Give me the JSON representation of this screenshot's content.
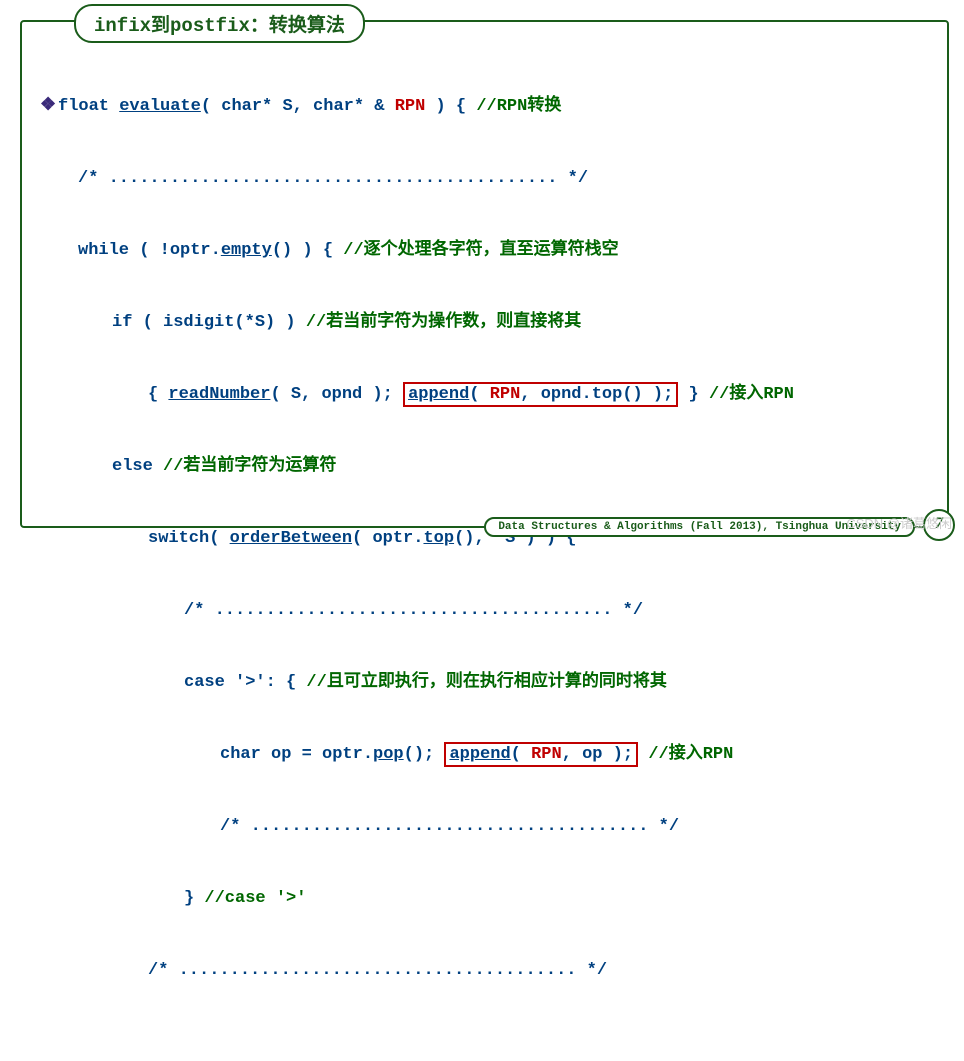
{
  "title": {
    "part1": "infix",
    "part2": "到",
    "part3": "postfix",
    "part4": "：转换算法"
  },
  "code": {
    "l1_bullet": "❖",
    "l1_a": "float ",
    "l1_fn": "evaluate",
    "l1_b": "( char* S, char* & ",
    "l1_rpn": "RPN",
    "l1_c": " ) { ",
    "l1_cmt": "//RPN转换",
    "l2": "/* ............................................ */",
    "l3_a": "while ( !optr.",
    "l3_fn": "empty",
    "l3_b": "() ) { ",
    "l3_cmt": "//逐个处理各字符，直至运算符栈空",
    "l4_a": "if ( isdigit(*S) ) ",
    "l4_cmt": "//若当前字符为操作数，则直接将其",
    "l5_a": "{ ",
    "l5_fn1": "readNumber",
    "l5_b": "( S, opnd ); ",
    "l5_fn2": "append",
    "l5_c": "( ",
    "l5_rpn": "RPN",
    "l5_d": ", opnd.top() );",
    "l5_e": " } ",
    "l5_cmt": "//接入RPN",
    "l6_a": "else ",
    "l6_cmt": "//若当前字符为运算符",
    "l7_a": "switch( ",
    "l7_fn1": "orderBetween",
    "l7_b": "( optr.",
    "l7_fn2": "top",
    "l7_c": "(), *S ) ) {",
    "l8": "/* ....................................... */",
    "l9_a": "case '>': { ",
    "l9_cmt": "//且可立即执行，则在执行相应计算的同时将其",
    "l10_a": "char op = optr.",
    "l10_fn1": "pop",
    "l10_b": "(); ",
    "l10_fn2": "append",
    "l10_c": "( ",
    "l10_rpn": "RPN",
    "l10_d": ", op );",
    "l10_e": " ",
    "l10_cmt": "//接入RPN",
    "l11": "/* ....................................... */",
    "l12_a": "} ",
    "l12_cmt": "//case '>'",
    "l13": "/* ....................................... */"
  },
  "footer": "Data Structures & Algorithms (Fall 2013), Tsinghua University",
  "page": "7",
  "watermark": "CSDN @诸葛悠闲"
}
